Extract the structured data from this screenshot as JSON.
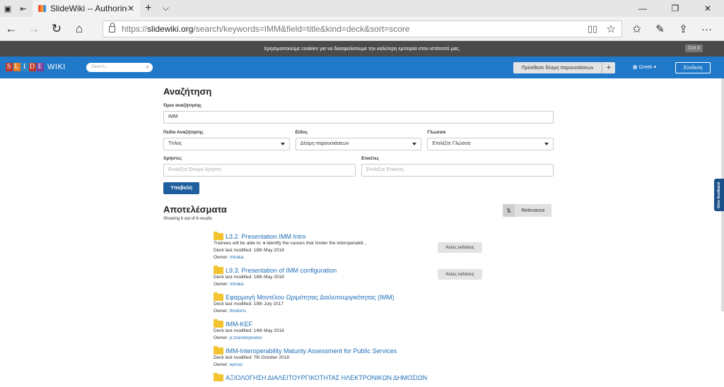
{
  "browser": {
    "tab_title": "SlideWiki -- Authoring p",
    "url_https": "https://",
    "url_host": "slidewiki.org",
    "url_path": "/search/keywords=IMM&field=title&kind=deck&sort=score"
  },
  "cookie": {
    "text": "Χρησιμοποιούμε cookies για να διασφαλίσουμε την καλύτερη εμπειρία στον ιστότοπό μας.",
    "button": "Got it"
  },
  "header": {
    "logo_letters": [
      "S",
      "L",
      "I",
      "D",
      "E"
    ],
    "logo_wiki": "WIKI",
    "search_placeholder": "Search...",
    "add_deck": "Πρόσθεσε δέσμη παρουσιάσεων",
    "language": "Greek",
    "signin": "Σύνδεση"
  },
  "form": {
    "title": "Αναζήτηση",
    "terms_label": "Όροι αναζήτησης",
    "terms_value": "IMM",
    "field_label": "Πεδίο Αναζήτησης",
    "field_value": "Τίτλος",
    "kind_label": "Είδος",
    "kind_value": "Δέσμη παρουσιάσεων",
    "lang_label": "Γλώσσα",
    "lang_value": "Επιλέξτε Γλώσσα",
    "users_label": "Χρήστες",
    "users_placeholder": "Επιλέξτε Όνομα Χρήστη",
    "tags_label": "Ετικέτες",
    "tags_placeholder": "Επιλέξτε Ετικέτες",
    "submit": "Υποβολή"
  },
  "results": {
    "title": "Αποτελέσματα",
    "showing": "Showing 6 out of 6 results",
    "sort": "Relevance",
    "items": [
      {
        "title": "L3.2. Presentation IMM Intro",
        "desc": "Trainees will be able to: ♦ Identify the causes that hinder the interoperabili...",
        "modified": "Deck last modified: 18th May 2018",
        "owner_prefix": "Owner: ",
        "owner": "mtraka",
        "other": "Άλλες εκδόσεις"
      },
      {
        "title": "L9.3. Presentation of IMM configuration",
        "desc": "",
        "modified": "Deck last modified: 18th May 2018",
        "owner_prefix": "Owner: ",
        "owner": "mtraka",
        "other": "Άλλες εκδόσεις"
      },
      {
        "title": "Εφαρμογή Μοντέλου Ωριμότητας Διαλειτουργικότητας (IMM)",
        "desc": "",
        "modified": "Deck last modified: 19th July 2017",
        "owner_prefix": "Owner: ",
        "owner": "thodoris",
        "other": ""
      },
      {
        "title": "IMM-KEF",
        "desc": "",
        "modified": "Deck last modified: 14th May 2018",
        "owner_prefix": "Owner: ",
        "owner": "p.tzanetopoulos",
        "other": ""
      },
      {
        "title": "IMM-Interoperability Maturity Assessment for Public Services",
        "desc": "",
        "modified": "Deck last modified: 7th October 2018",
        "owner_prefix": "Owner: ",
        "owner": "eproui",
        "other": ""
      },
      {
        "title": "ΑΞΙΟΛΟΓΗΣΗ ΔΙΑΛΕΙΤΟΥΡΓΙΚΟΤΗΤΑΣ ΗΛΕΚΤΡΟΝΙΚΩΝ ΔΗΜΟΣΙΩΝ",
        "desc": "",
        "modified": "",
        "owner_prefix": "",
        "owner": "",
        "other": ""
      }
    ]
  },
  "feedback": "Give feedback",
  "colors": {
    "header_blue": "#1f78c8",
    "link_blue": "#1f6fb8",
    "submit_blue": "#1f5f9e",
    "folder_yellow": "#f4c430"
  }
}
